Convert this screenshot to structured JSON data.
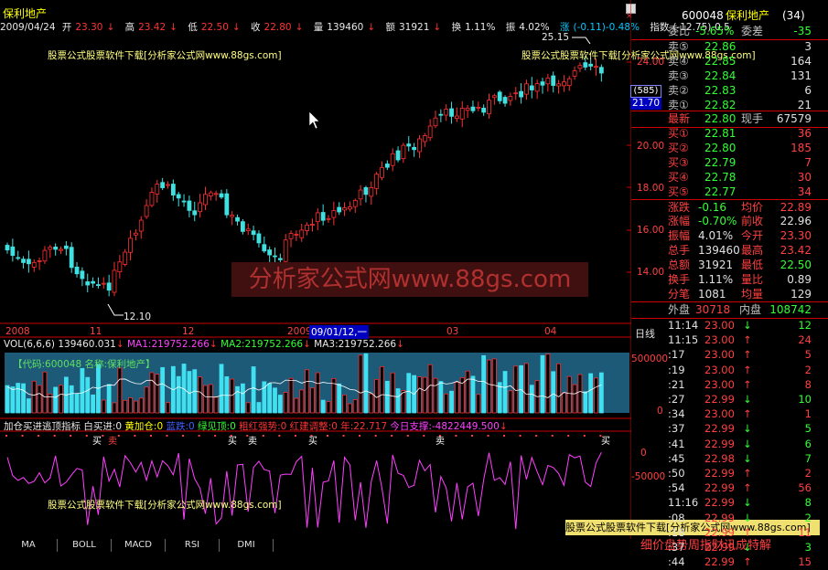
{
  "window": {
    "title": "保利地产",
    "restore_icon": "restore-icon",
    "close_icon": "close-icon"
  },
  "infobar": {
    "date": "2009/04/24",
    "open_label": "开",
    "open": "23.30",
    "high_label": "高",
    "high": "23.42",
    "low_label": "低",
    "low": "22.50",
    "close_label": "收",
    "close": "22.80",
    "vol_label": "量",
    "vol": "139460",
    "amt_label": "额",
    "amt": "31921",
    "turn_label": "换",
    "turn": "1.11%",
    "amp_label": "振",
    "amp": "4.02%",
    "chg_label": "涨",
    "chg": "(-0.11)-0.48%",
    "idx_label": "指数",
    "idx": "(-12.75)-0.5"
  },
  "watermarks": {
    "line1": "股票公式股票软件下载[分析家公式网www.88gs.com]",
    "big": "分析家公式网www.88gs.com",
    "bottom_box": "股票公式股票软件下载[分析家公式网www.88gs.com]",
    "ticker": "细价盘势周指财讯成特解"
  },
  "price_chart": {
    "y_ticks": [
      "24.00",
      "22.00",
      "20.00",
      "18.00",
      "16.00",
      "14.00"
    ],
    "current_price_box": "21.70",
    "current_badge": "(585)",
    "max_label": "25.15",
    "min_label": "12.10",
    "x_ticks": [
      "2008",
      "11",
      "12",
      "2009",
      "03",
      "04"
    ],
    "cursor_date": "09/01/12,一",
    "day_label": "日线"
  },
  "volume_chart": {
    "header": "VOL(6,6,6)",
    "vol": "139460.031",
    "ma1": "MA1:219752.266",
    "ma2": "MA2:219752.266",
    "ma3": "MA3:219752.266",
    "info": "【代码:600048 名称:保利地产】",
    "y_ticks": [
      "500000",
      "0"
    ]
  },
  "indicator": {
    "name": "加仓买进逃顶指标",
    "white_label": "白买进:0",
    "yellow_label": "黄加仓:0",
    "blue_label": "蓝跌:0",
    "green_label": "绿见顶:0",
    "red_label": "粗红强势:0",
    "red2_label": "红建调整:0",
    "year_label": "年:22.717",
    "support_label": "今日支撑:-4822449.500",
    "y_ticks": [
      "0",
      "-50000"
    ],
    "buy_marks": [
      "买",
      "卖",
      "买",
      "卖",
      "买",
      "卖",
      "买"
    ]
  },
  "tabs": [
    "MA",
    "BOLL",
    "MACD",
    "RSI",
    "DMI"
  ],
  "quote": {
    "code": "600048",
    "name": "保利地产",
    "count": "(34)",
    "ratio_label": "委比",
    "ratio": "-5.65%",
    "diff_label": "委差",
    "diff": "-35",
    "asks": [
      {
        "label": "卖⑤",
        "price": "22.86",
        "vol": "3"
      },
      {
        "label": "卖④",
        "price": "22.85",
        "vol": "164"
      },
      {
        "label": "卖③",
        "price": "22.84",
        "vol": "131"
      },
      {
        "label": "卖②",
        "price": "22.83",
        "vol": "6"
      },
      {
        "label": "卖①",
        "price": "22.82",
        "vol": "21"
      }
    ],
    "last_label": "最新",
    "last": "22.80",
    "hand_label": "现手",
    "hand": "67579",
    "bids": [
      {
        "label": "买①",
        "price": "22.81",
        "vol": "36"
      },
      {
        "label": "买②",
        "price": "22.80",
        "vol": "185"
      },
      {
        "label": "买③",
        "price": "22.79",
        "vol": "7"
      },
      {
        "label": "买④",
        "price": "22.78",
        "vol": "30"
      },
      {
        "label": "买⑤",
        "price": "22.77",
        "vol": "34"
      }
    ],
    "stats": [
      {
        "l1": "涨跌",
        "v1": "-0.16",
        "l2": "均价",
        "v2": "22.89",
        "c1": "grn",
        "c2": "red"
      },
      {
        "l1": "涨幅",
        "v1": "-0.70%",
        "l2": "前收",
        "v2": "22.96",
        "c1": "grn",
        "c2": "wht"
      },
      {
        "l1": "振幅",
        "v1": "4.01%",
        "l2": "今开",
        "v2": "23.30",
        "c1": "wht",
        "c2": "red"
      },
      {
        "l1": "总手",
        "v1": "139460",
        "l2": "最高",
        "v2": "23.42",
        "c1": "wht",
        "c2": "red"
      },
      {
        "l1": "总额",
        "v1": "31921",
        "l2": "最低",
        "v2": "22.50",
        "c1": "wht",
        "c2": "grn"
      },
      {
        "l1": "换手",
        "v1": "1.11%",
        "l2": "量比",
        "v2": "0.89",
        "c1": "wht",
        "c2": "wht"
      },
      {
        "l1": "分笔",
        "v1": "1081",
        "l2": "均量",
        "v2": "129",
        "c1": "wht",
        "c2": "wht"
      }
    ],
    "outer_label": "外盘",
    "outer": "30718",
    "inner_label": "内盘",
    "inner": "108742",
    "ticks": [
      {
        "t": "11:14",
        "p": "23.00",
        "d": "↓",
        "v": "12"
      },
      {
        "t": "11:15",
        "p": "23.00",
        "d": "↑",
        "v": "24"
      },
      {
        "t": ":17",
        "p": "23.00",
        "d": "↑",
        "v": "5"
      },
      {
        "t": ":19",
        "p": "23.00",
        "d": "↑",
        "v": "2"
      },
      {
        "t": ":21",
        "p": "23.00",
        "d": "↑",
        "v": "8"
      },
      {
        "t": ":27",
        "p": "22.99",
        "d": "↓",
        "v": "10"
      },
      {
        "t": ":34",
        "p": "23.00",
        "d": "↑",
        "v": "1"
      },
      {
        "t": ":37",
        "p": "22.99",
        "d": "↓",
        "v": "5"
      },
      {
        "t": ":41",
        "p": "22.99",
        "d": "↓",
        "v": "6"
      },
      {
        "t": ":45",
        "p": "22.98",
        "d": "↓",
        "v": "7"
      },
      {
        "t": ":50",
        "p": "22.99",
        "d": "↑",
        "v": "2"
      },
      {
        "t": ":54",
        "p": "22.99",
        "d": "↑",
        "v": "56"
      },
      {
        "t": "11:16",
        "p": "22.99",
        "d": "↓",
        "v": "8"
      },
      {
        "t": ":08",
        "p": "22.99",
        "d": "↓",
        "v": "2"
      },
      {
        "t": ":18",
        "p": "22.99",
        "d": "↑",
        "v": "11"
      },
      {
        "t": ":37",
        "p": "22.99",
        "d": "↓",
        "v": "3"
      },
      {
        "t": ":44",
        "p": "22.99",
        "d": "↑",
        "v": "15"
      }
    ]
  }
}
